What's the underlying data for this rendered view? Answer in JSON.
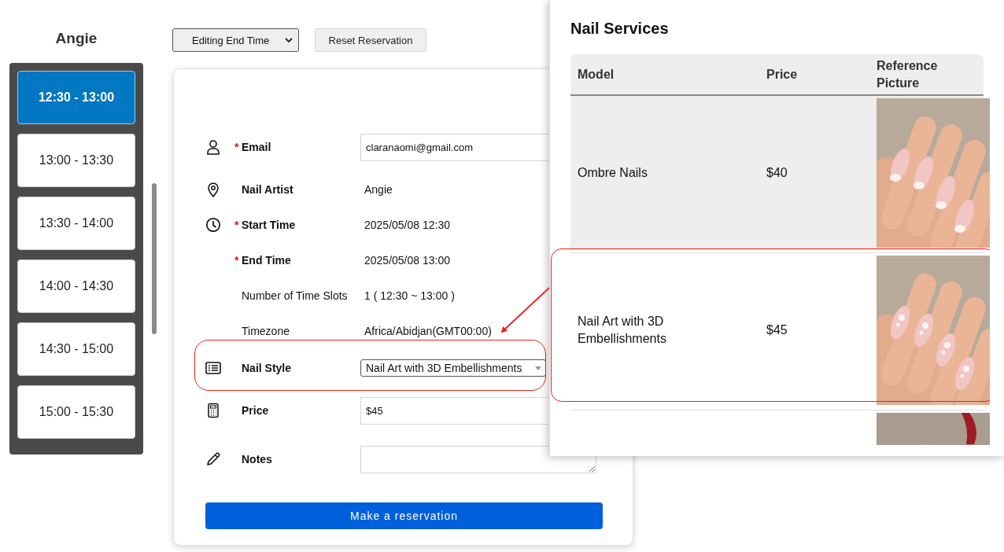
{
  "artist": {
    "name": "Angie"
  },
  "time_slots": [
    {
      "label": "12:30 - 13:00",
      "selected": true
    },
    {
      "label": "13:00 - 13:30",
      "selected": false
    },
    {
      "label": "13:30 - 14:00",
      "selected": false
    },
    {
      "label": "14:00 - 14:30",
      "selected": false
    },
    {
      "label": "14:30 - 15:00",
      "selected": false
    },
    {
      "label": "15:00 - 15:30",
      "selected": false
    }
  ],
  "toolbar": {
    "mode_select": {
      "value": "Editing End Time"
    },
    "reset_button": "Reset Reservation"
  },
  "form": {
    "fields": [
      {
        "kind": "input",
        "label": "Email",
        "required_mark": "*",
        "value": "claranaomi@gmail.com"
      },
      {
        "kind": "text",
        "label": "Nail Artist",
        "value": "Angie"
      },
      {
        "kind": "text",
        "label": "Start Time",
        "required_mark": "*",
        "value": "2025/05/08 12:30"
      },
      {
        "kind": "text",
        "label": "End Time",
        "required_mark": "*",
        "value": "2025/05/08 13:00"
      },
      {
        "kind": "plain",
        "label": "Number of Time Slots",
        "value": "1 ( 12:30 ~ 13:00 )"
      },
      {
        "kind": "plain",
        "label": "Timezone",
        "value": "Africa/Abidjan(GMT00:00)"
      },
      {
        "kind": "select",
        "label": "Nail Style",
        "value": "Nail Art with 3D Embellishments",
        "highlighted": true
      },
      {
        "kind": "input",
        "label": "Price",
        "value": "$45"
      },
      {
        "kind": "textarea",
        "label": "Notes"
      }
    ],
    "submit_button": "Make a reservation"
  },
  "services": {
    "title": "Nail Services",
    "columns": [
      "Model",
      "Price",
      "Reference Picture"
    ],
    "rows": [
      {
        "model": "Ombre Nails",
        "price": "$40",
        "picture": {
          "kind": "picture"
        },
        "highlighted": false
      },
      {
        "model": "Nail Art with 3D Embellishments",
        "price": "$45",
        "picture": {
          "kind": "picture"
        },
        "highlighted": true
      },
      {
        "picture": {
          "kind": "picture"
        }
      }
    ]
  },
  "callout_arrow": true
}
